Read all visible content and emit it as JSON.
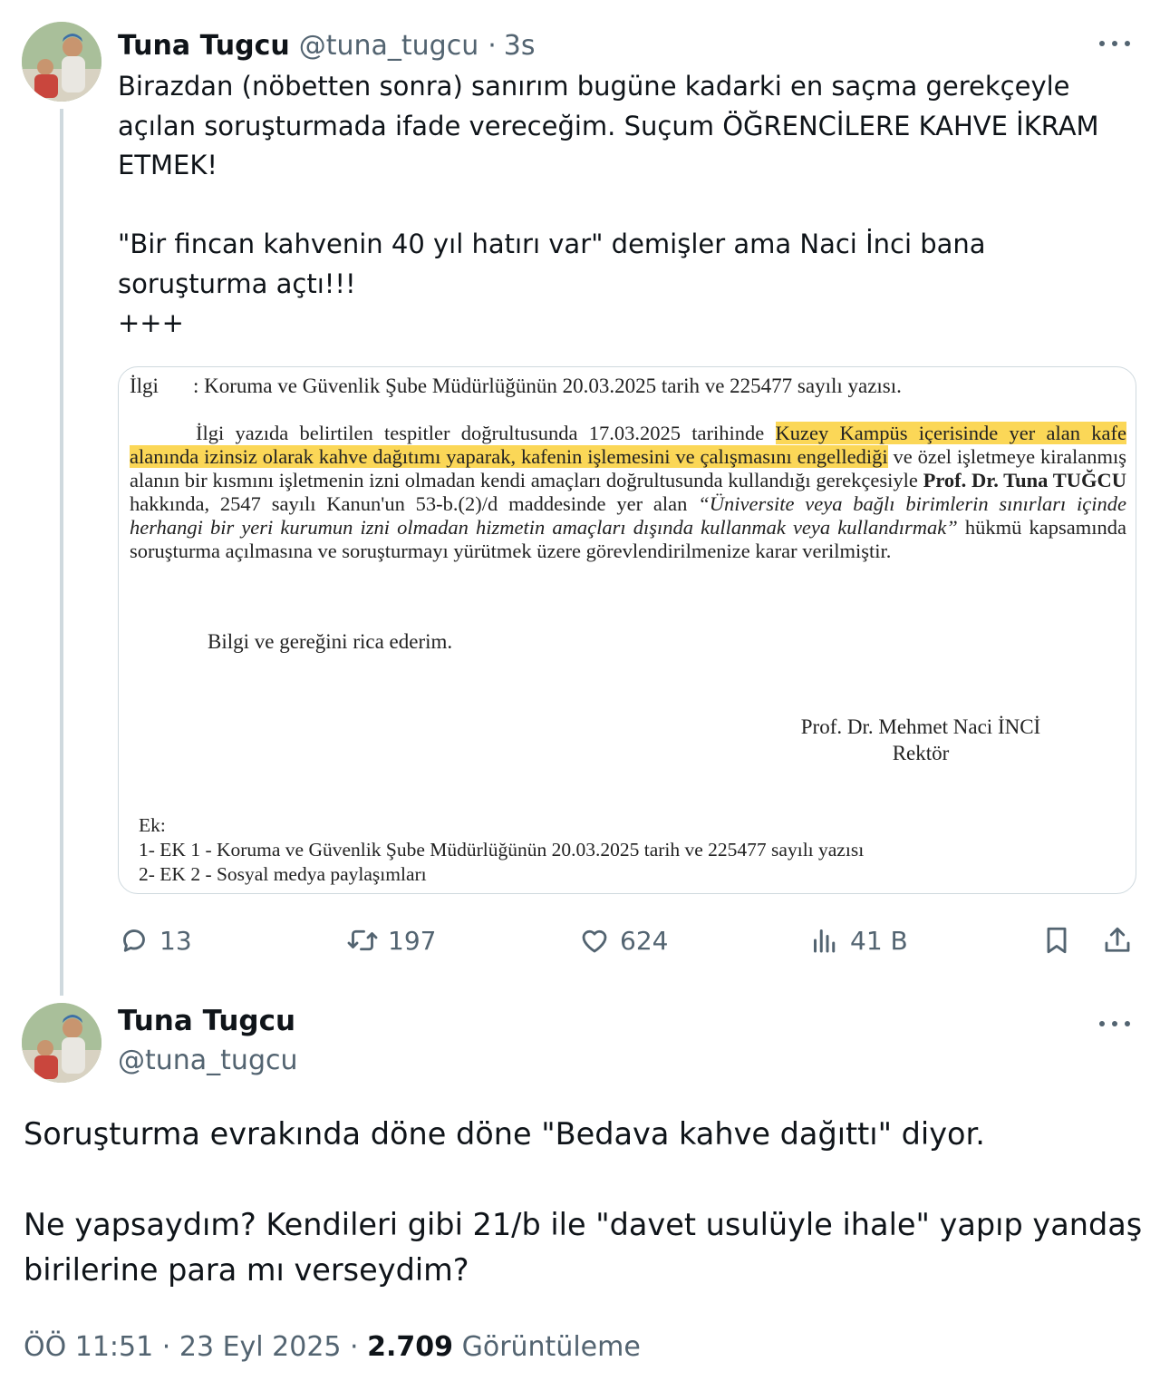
{
  "tweet1": {
    "name": "Tuna Tugcu",
    "handle": "@tuna_tugcu",
    "separator": "·",
    "time": "3s",
    "text": "Birazdan (nöbetten sonra) sanırım bugüne kadarki en saçma gerekçeyle açılan soruşturmada ifade vereceğim. Suçum ÖĞRENCİLERE KAHVE İKRAM ETMEK!\n\n\"Bir fincan kahvenin 40 yıl hatırı var\" demişler ama Naci İnci bana soruşturma açtı!!!\n+++",
    "document": {
      "ref_label": "İlgi",
      "ref_text": ": Koruma ve Güvenlik Şube Müdürlüğünün 20.03.2025 tarih ve 225477 sayılı yazısı.",
      "body_part1": "İlgi yazıda belirtilen tespitler doğrultusunda 17.03.2025 tarihinde ",
      "body_highlight": "Kuzey Kampüs içerisinde yer alan kafe alanında izinsiz olarak kahve dağıtımı yaparak, kafenin işlemesini ve çalışmasını engellediği",
      "body_part2": " ve özel işletmeye kiralanmış alanın bir kısmını işletmenin izni olmadan kendi amaçları doğrultusunda kullandığı gerekçesiyle ",
      "body_bold": "Prof. Dr. Tuna TUĞCU",
      "body_part3": " hakkında, 2547 sayılı Kanun'un 53-b.(2)/d maddesinde yer alan ",
      "body_italic": "“Üniversite veya bağlı birimlerin sınırları içinde herhangi bir yeri kurumun izni olmadan hizmetin amaçları dışında kullanmak veya kullandırmak”",
      "body_part4": " hükmü kapsamında soruşturma açılmasına ve soruşturmayı yürütmek üzere görevlendirilmenize karar verilmiştir.",
      "closing": "Bilgi ve gereğini rica ederim.",
      "signer_name": "Prof. Dr. Mehmet Naci İNCİ",
      "signer_title": "Rektör",
      "ek_label": "Ek:",
      "ek_1": "1- EK 1 - Koruma ve Güvenlik Şube Müdürlüğünün 20.03.2025 tarih ve 225477 sayılı yazısı",
      "ek_2": "2- EK 2 - Sosyal medya paylaşımları"
    },
    "actions": {
      "replies": "13",
      "retweets": "197",
      "likes": "624",
      "views": "41 B"
    }
  },
  "tweet2": {
    "name": "Tuna Tugcu",
    "handle": "@tuna_tugcu",
    "text": "Soruşturma evrakında döne döne \"Bedava kahve dağıttı\" diyor.\n\nNe yapsaydım? Kendileri gibi 21/b ile \"davet usulüyle ihale\" yapıp yandaş birilerine para mı verseydim?",
    "time": "ÖÖ 11:51",
    "separator": "·",
    "date": "23 Eyl 2025",
    "views_count": "2.709",
    "views_label": "Görüntüleme"
  },
  "icons": {
    "reply": "reply-icon",
    "retweet": "retweet-icon",
    "like": "heart-icon",
    "views": "analytics-icon",
    "bookmark": "bookmark-icon",
    "share": "share-icon",
    "more": "more-icon"
  },
  "colors": {
    "text": "#0f1419",
    "secondary": "#536471",
    "border": "#cfd9de",
    "highlight": "#fbd757"
  }
}
